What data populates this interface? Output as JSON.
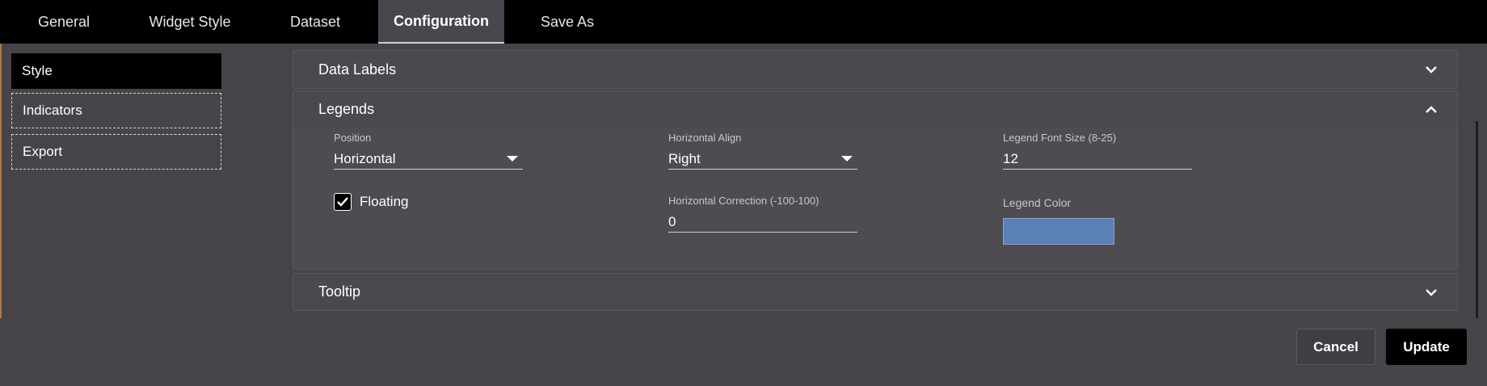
{
  "tabs": [
    {
      "label": "General"
    },
    {
      "label": "Widget Style"
    },
    {
      "label": "Dataset"
    },
    {
      "label": "Configuration",
      "active": true
    },
    {
      "label": "Save As"
    }
  ],
  "sidebar": {
    "items": [
      {
        "label": "Style",
        "active": true
      },
      {
        "label": "Indicators"
      },
      {
        "label": "Export"
      }
    ]
  },
  "sections": {
    "data_labels": {
      "title": "Data Labels",
      "icon": "chevron-down-icon"
    },
    "legends": {
      "title": "Legends",
      "icon": "chevron-up-icon",
      "position": {
        "label": "Position",
        "value": "Horizontal"
      },
      "horizontal_align": {
        "label": "Horizontal Align",
        "value": "Right"
      },
      "font_size": {
        "label": "Legend Font Size (8-25)",
        "value": "12"
      },
      "floating": {
        "label": "Floating",
        "checked": true
      },
      "horizontal_correction": {
        "label": "Horizontal Correction (-100-100)",
        "value": "0"
      },
      "legend_color": {
        "label": "Legend Color",
        "color": "#5b80b5"
      }
    },
    "tooltip": {
      "title": "Tooltip",
      "icon": "chevron-down-icon"
    }
  },
  "actions": {
    "cancel_label": "Cancel",
    "update_label": "Update"
  },
  "colors": {
    "background": "#474449",
    "topbar": "#000000",
    "accent_swatch": "#5b80b5"
  }
}
